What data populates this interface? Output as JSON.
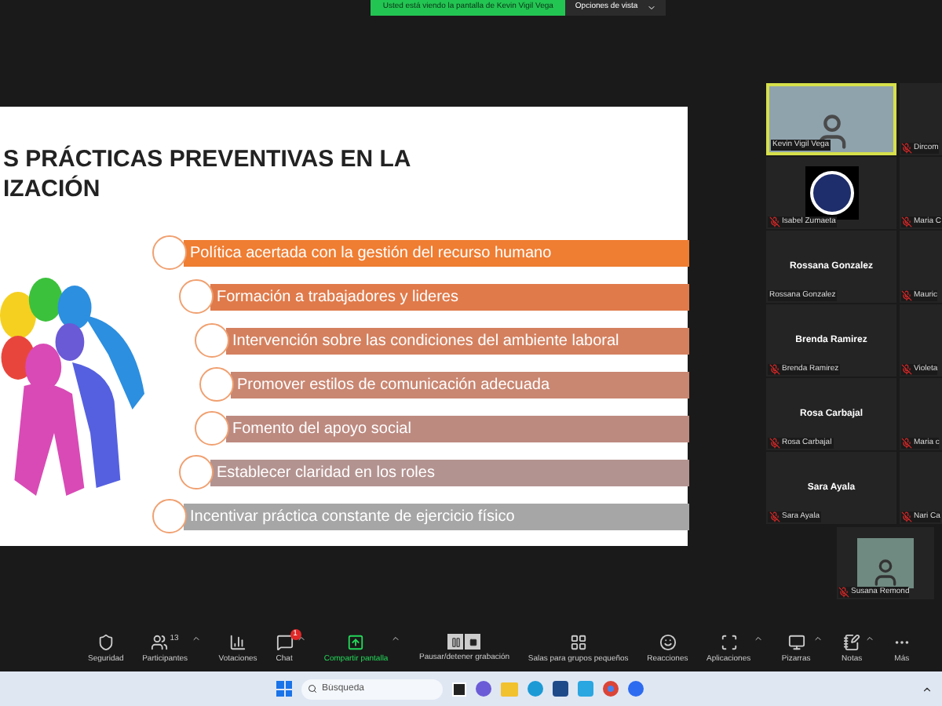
{
  "banner": {
    "text": "Usted está viendo la pantalla de Kevin Vigil Vega",
    "view_options": "Opciones de vista"
  },
  "slide": {
    "title_lines": [
      "S PRÁCTICAS PREVENTIVAS EN LA",
      "IZACIÓN"
    ],
    "items": [
      {
        "text": "Política acertada con la gestión del recurso humano",
        "color": "#ef7d32"
      },
      {
        "text": "Formación a trabajadores y lideres",
        "color": "#e07a4a"
      },
      {
        "text": "Intervención sobre las condiciones del ambiente laboral",
        "color": "#d4805f"
      },
      {
        "text": "Promover estilos de comunicación adecuada",
        "color": "#c98671"
      },
      {
        "text": "Fomento del apoyo social",
        "color": "#bd8a80"
      },
      {
        "text": "Establecer claridad en los roles",
        "color": "#b39390"
      },
      {
        "text": "Incentivar práctica constante de ejercicio físico",
        "color": "#a6a6a6"
      }
    ]
  },
  "gallery": {
    "rows": [
      {
        "main": {
          "kind": "video",
          "label": "Kevin Vigil Vega",
          "muted": false,
          "speaking": true
        },
        "side": {
          "label": "Dircom",
          "muted": true
        }
      },
      {
        "main": {
          "kind": "logo",
          "label": "Isabel Zumaeta",
          "muted": true,
          "speaking": false
        },
        "side": {
          "label": "Maria C",
          "muted": true
        }
      },
      {
        "main": {
          "kind": "name",
          "name": "Rossana Gonzalez",
          "label": "Rossana Gonzalez",
          "muted": false,
          "speaking": false
        },
        "side": {
          "label": "Mauric",
          "muted": true
        }
      },
      {
        "main": {
          "kind": "name",
          "name": "Brenda Ramirez",
          "label": "Brenda Ramirez",
          "muted": true,
          "speaking": false
        },
        "side": {
          "label": "Violeta",
          "muted": true
        }
      },
      {
        "main": {
          "kind": "name",
          "name": "Rosa Carbajal",
          "label": "Rosa Carbajal",
          "muted": true,
          "speaking": false
        },
        "side": {
          "label": "Maria c",
          "muted": true
        }
      },
      {
        "main": {
          "kind": "name",
          "name": "Sara Ayala",
          "label": "Sara Ayala",
          "muted": true,
          "speaking": false
        },
        "side": {
          "label": "Nari Ca",
          "muted": true
        }
      }
    ],
    "last": {
      "kind": "video",
      "label": "Susana Remond",
      "muted": true
    }
  },
  "toolbar": [
    {
      "kind": "security",
      "label": "Seguridad",
      "caret": false,
      "active": false
    },
    {
      "kind": "participants",
      "label": "Participantes",
      "count": "13",
      "caret": true,
      "active": false
    },
    {
      "kind": "polls",
      "label": "Votaciones",
      "caret": false,
      "active": false
    },
    {
      "kind": "chat",
      "label": "Chat",
      "badge": "1",
      "caret": true,
      "active": false
    },
    {
      "kind": "share",
      "label": "Compartir pantalla",
      "caret": true,
      "active": true
    },
    {
      "kind": "record",
      "label": "Pausar/detener grabación",
      "caret": false,
      "active": false
    },
    {
      "kind": "rooms",
      "label": "Salas para grupos pequeños",
      "caret": false,
      "active": false
    },
    {
      "kind": "reactions",
      "label": "Reacciones",
      "caret": false,
      "active": false
    },
    {
      "kind": "apps",
      "label": "Aplicaciones",
      "caret": true,
      "active": false
    },
    {
      "kind": "whiteboards",
      "label": "Pizarras",
      "caret": true,
      "active": false
    },
    {
      "kind": "notes",
      "label": "Notas",
      "caret": true,
      "active": false
    },
    {
      "kind": "more",
      "label": "Más",
      "caret": false,
      "active": false
    }
  ],
  "taskbar": {
    "search": {
      "placeholder": "Búsqueda"
    }
  }
}
